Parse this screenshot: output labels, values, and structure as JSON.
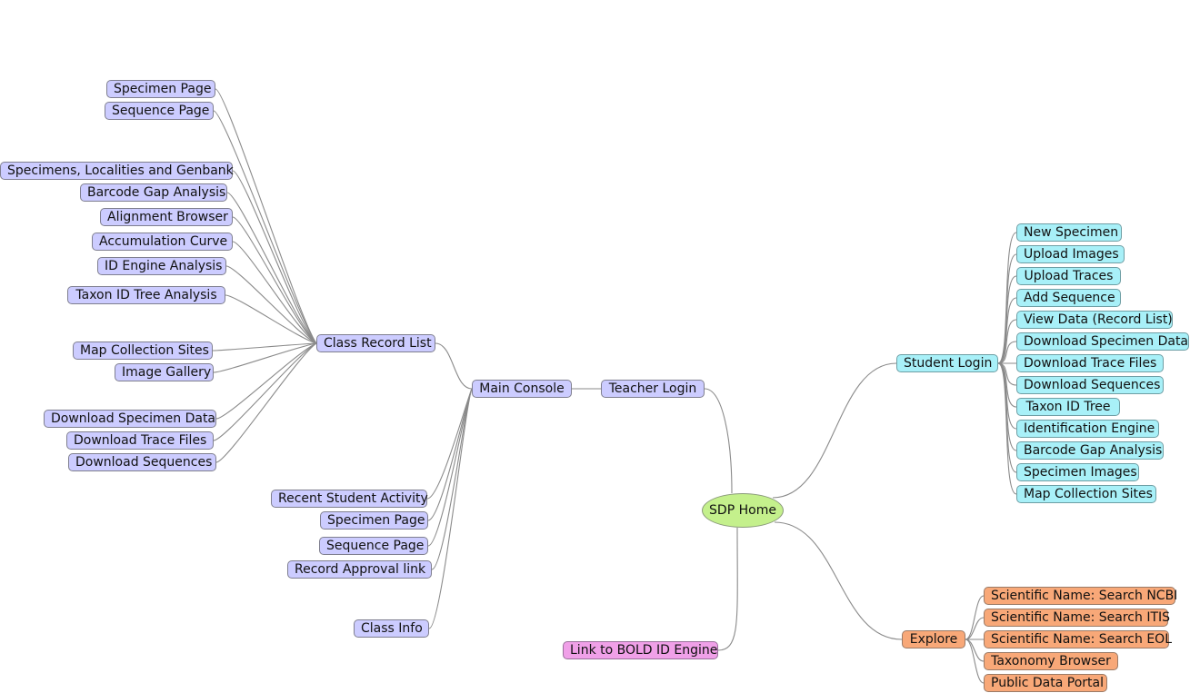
{
  "colors": {
    "teacher_branch": "#ccccff",
    "student_branch": "#a8f0f8",
    "explore_branch": "#f8a878",
    "bold_link": "#f0a0e8",
    "root": "#c4f08c",
    "edge": "#8a8a8a"
  },
  "root": {
    "label": "SDP Home"
  },
  "teacher": {
    "login": "Teacher Login",
    "main_console": "Main Console",
    "class_record_list": "Class Record List",
    "class_record_children": [
      "Specimen Page",
      "Sequence Page",
      "Specimens, Localities and Genbank",
      "Barcode Gap Analysis",
      "Alignment Browser",
      "Accumulation Curve",
      "ID Engine Analysis",
      "Taxon ID Tree Analysis",
      "Map Collection Sites",
      "Image Gallery",
      "Download Specimen Data",
      "Download Trace Files",
      "Download Sequences"
    ],
    "console_children": [
      "Recent Student Activity",
      "Specimen Page",
      "Sequence Page",
      "Record Approval link",
      "Class Info"
    ]
  },
  "student": {
    "login": "Student Login",
    "children": [
      "New Specimen",
      "Upload Images",
      "Upload Traces",
      "Add Sequence",
      "View Data (Record List)",
      "Download Specimen Data",
      "Download Trace Files",
      "Download Sequences",
      "Taxon ID Tree",
      "Identification Engine",
      "Barcode Gap Analysis",
      "Specimen Images",
      "Map Collection Sites"
    ]
  },
  "explore": {
    "label": "Explore",
    "children": [
      "Scientific Name: Search NCBI",
      "Scientific Name: Search ITIS",
      "Scientific Name: Search EOL",
      "Taxonomy Browser",
      "Public Data Portal"
    ]
  },
  "bold": {
    "label": "Link to BOLD ID Engine"
  }
}
